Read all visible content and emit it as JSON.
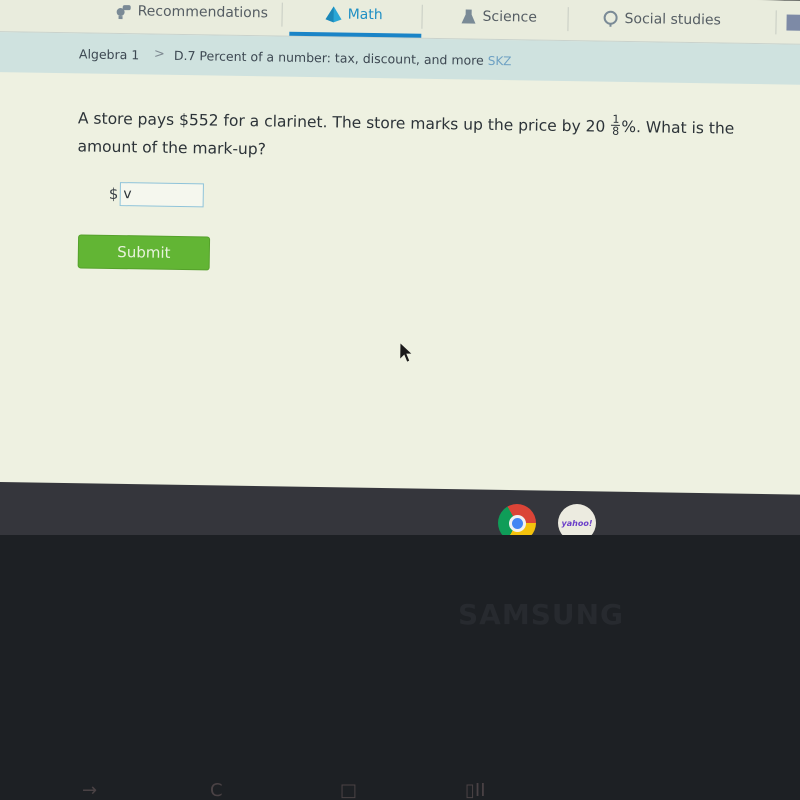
{
  "nav": {
    "items": [
      {
        "label": "Recommendations",
        "icon": "recommendations-icon",
        "active": false
      },
      {
        "label": "Math",
        "icon": "math-pyramid-icon",
        "active": true
      },
      {
        "label": "Science",
        "icon": "science-flask-icon",
        "active": false
      },
      {
        "label": "Social studies",
        "icon": "globe-icon",
        "active": false
      }
    ],
    "accent": "#1a84c7"
  },
  "breadcrumb": {
    "course": "Algebra 1",
    "separator": ">",
    "skill": "D.7 Percent of a number: tax, discount, and more",
    "skill_code": "SKZ"
  },
  "question": {
    "text_before": "A store pays $552 for a clarinet. The store marks up the price by 20",
    "fraction_numerator": "1",
    "fraction_denominator": "8",
    "text_after": "%. What is the amount of the mark-up?"
  },
  "answer": {
    "prefix": "$",
    "value": "v",
    "placeholder": ""
  },
  "submit": {
    "label": "Submit",
    "color": "#62b534"
  },
  "shelf": {
    "apps": [
      {
        "name": "Chrome",
        "icon": "chrome-icon",
        "running": true
      },
      {
        "name": "Yahoo",
        "icon": "yahoo-icon",
        "label": "yahoo!",
        "running": false
      }
    ]
  },
  "device": {
    "brand": "SAMSUNG"
  },
  "keyboard": {
    "keys": [
      "→",
      "C",
      "□",
      "▯II"
    ]
  }
}
